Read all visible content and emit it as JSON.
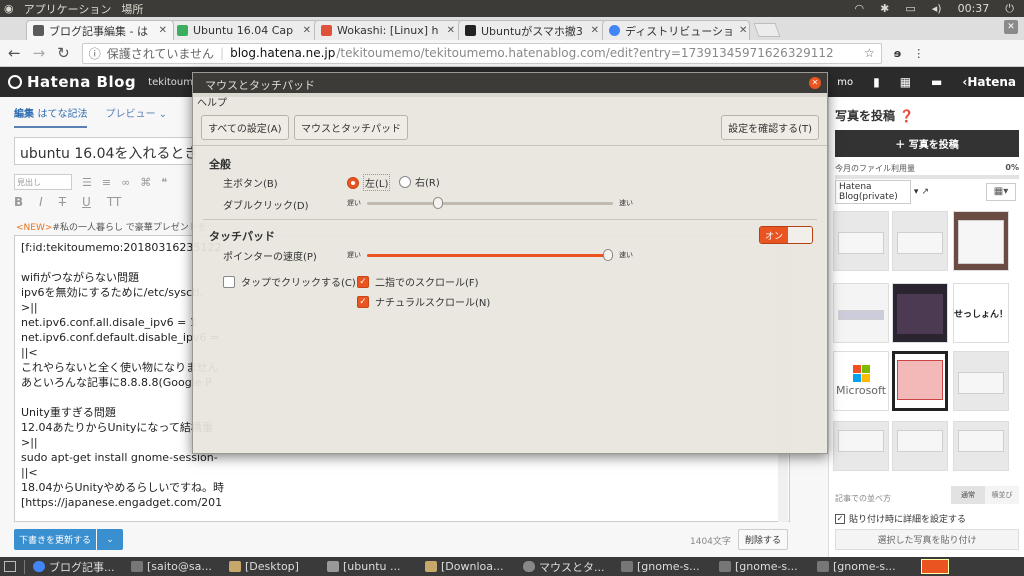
{
  "panel": {
    "apps": "アプリケーション",
    "places": "場所",
    "clock": "00:37"
  },
  "tabs": [
    {
      "label": "ブログ記事編集 - は",
      "color": "#5a5a5a"
    },
    {
      "label": "Ubuntu 16.04 Cap",
      "color": "#3dae5e"
    },
    {
      "label": "Wokashi: [Linux] h",
      "color": "#e0533a"
    },
    {
      "label": "Ubuntuがスマホ撤3",
      "color": "#222222"
    },
    {
      "label": "ディストリビューショ",
      "color": "#4285f4"
    }
  ],
  "url": {
    "security": "保護されていません",
    "host": "blog.hatena.ne.jp",
    "path": "/tekitoumemo/tekitoumemo.hatenablog.com/edit?entry=17391345971626329112"
  },
  "hatena": {
    "logo": "Hatena Blog",
    "blogname": "tekitoumemo's",
    "brand": "Hatena",
    "memo": "mo"
  },
  "editor": {
    "tab_edit": "編集",
    "tab_edit_sub": "はてな記法",
    "tab_preview": "プレビュー",
    "title": "ubuntu 16.04を入れるときにや",
    "heading_select": "見出し",
    "news": {
      "tag": "<NEW>",
      "text": "#私の一人暮らし で豪華プレゼントを"
    },
    "body_lines": [
      "[f:id:tekitoumemo:20180316235122",
      "",
      "wifiがつながらない問題",
      "ipv6を無効にするために/etc/sysctl.",
      ">||",
      "net.ipv6.conf.all.disale_ipv6 = 1",
      "net.ipv6.conf.default.disable_ipv6 =",
      "||<",
      "これやらないと全く使い物になりません",
      "あといろんな記事に8.8.8.8(Google P",
      "",
      "Unity重すぎる問題",
      "12.04あたりからUnityになって結構重",
      ">||",
      "sudo apt-get install gnome-session-",
      "||<",
      "18.04からUnityやめるらしいですね。時",
      "[https://japanese.engadget.com/201"
    ],
    "update_button": "下書きを更新する",
    "char_count": "1404文字",
    "delete_button": "削除する"
  },
  "sidebar": {
    "title": "写真を投稿",
    "post_button": "写真を投稿",
    "usage_label": "今月のファイル利用量",
    "usage_value": "0%",
    "usage_fraction": 0,
    "album": "Hatena Blog(private)",
    "thumb_text_1": "せっしょん！",
    "thumb_text_2": "Microsoft",
    "sort_label": "記事での並べ方",
    "sort_normal": "通常",
    "sort_horizontal": "横並び",
    "detail_label": "貼り付け時に詳細を設定する",
    "paste_button": "選択した写真を貼り付け"
  },
  "dialog": {
    "title": "マウスとタッチパッド",
    "menu_help": "ヘルプ",
    "btn_all_settings": "すべての設定(A)",
    "btn_mouse": "マウスとタッチパッド",
    "btn_test": "設定を確認する(T)",
    "general": "全般",
    "primary_button": "主ボタン(B)",
    "left": "左(L)",
    "right": "右(R)",
    "double_click": "ダブルクリック(D)",
    "slow": "遅い",
    "fast": "速い",
    "double_click_level": 0.28,
    "touchpad": "タッチパッド",
    "toggle_on": "オン",
    "pointer_speed": "ポインターの速度(P)",
    "pointer_speed_level": 1.0,
    "tap_to_click": "タップでクリックする(C)",
    "two_finger_scroll": "二指でのスクロール(F)",
    "natural_scroll": "ナチュラルスクロール(N)"
  },
  "taskbar": [
    "ブログ記事...",
    "[saito@sa...",
    "[Desktop]",
    "[ubuntu ...",
    "[Downloa...",
    "マウスとタ...",
    "[gnome-s...",
    "[gnome-s...",
    "[gnome-s..."
  ],
  "colors": {
    "accent": "#e95420",
    "hatena_blue": "#3a8fd1"
  }
}
